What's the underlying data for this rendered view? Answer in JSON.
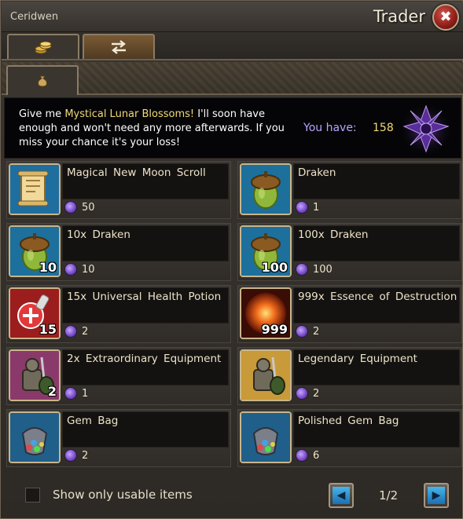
{
  "window": {
    "npc_name": "Ceridwen",
    "title": "Trader",
    "close_glyph": "✖"
  },
  "tabs": [
    {
      "icon": "coins-icon",
      "active": true
    },
    {
      "icon": "swap-arrows-icon",
      "active": false
    }
  ],
  "subtabs": [
    {
      "icon": "money-bag-icon",
      "active": true
    }
  ],
  "banner": {
    "text_pre": "Give me ",
    "text_highlight": "Mystical Lunar Blossoms!",
    "text_post": " I'll soon have enough and won't need any more afterwards. If you miss your chance it's your loss!",
    "you_have_label": "You have:",
    "you_have_value": "158",
    "currency_icon": "lunar-blossom-icon"
  },
  "items": [
    {
      "name": "Magical New Moon Scroll",
      "price": "50",
      "qty": "",
      "icon": "scroll-icon"
    },
    {
      "name": "Draken",
      "price": "1",
      "qty": "",
      "icon": "acorn-icon"
    },
    {
      "name": "10x Draken",
      "price": "10",
      "qty": "10",
      "icon": "acorn-icon"
    },
    {
      "name": "100x Draken",
      "price": "100",
      "qty": "100",
      "icon": "acorn-icon"
    },
    {
      "name": "15x Universal Health Potion",
      "price": "2",
      "qty": "15",
      "icon": "health-potion-icon"
    },
    {
      "name": "999x Essence of Destruction",
      "price": "2",
      "qty": "999",
      "icon": "essence-icon"
    },
    {
      "name": "2x Extraordinary Equipment",
      "price": "1",
      "qty": "2",
      "icon": "equipment-pile-icon"
    },
    {
      "name": "Legendary Equipment",
      "price": "2",
      "qty": "",
      "icon": "equipment-pile-icon"
    },
    {
      "name": "Gem Bag",
      "price": "2",
      "qty": "",
      "icon": "gem-bag-icon"
    },
    {
      "name": "Polished Gem Bag",
      "price": "6",
      "qty": "",
      "icon": "gem-bag-icon"
    }
  ],
  "footer": {
    "checkbox_label": "Show only usable items",
    "checkbox_checked": false,
    "page_indicator": "1/2",
    "prev_glyph": "◀",
    "next_glyph": "▶"
  },
  "colors": {
    "highlight": "#f0d977",
    "you_have": "#b9a4ff",
    "currency": "#7b4fc9",
    "close": "#8e1c17"
  }
}
